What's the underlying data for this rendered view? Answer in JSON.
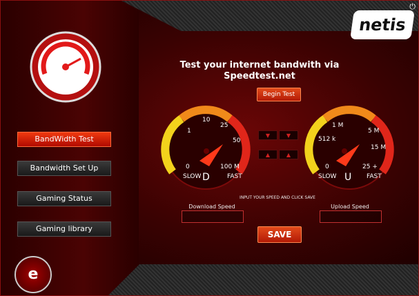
{
  "header": {
    "brand": "netis",
    "power_icon": "power-icon"
  },
  "main": {
    "title_line1": "Test your internet bandwith via",
    "title_line2": "Speedtest.net",
    "begin_button": "Begin Test",
    "hint": "INPUT YOUR SPEED AND CLICK SAVE",
    "download_label": "Download Speed",
    "upload_label": "Upload Speed",
    "save_button": "SAVE",
    "download_value": "",
    "upload_value": ""
  },
  "sidebar": {
    "items": [
      {
        "label": "BandWidth Test",
        "active": true
      },
      {
        "label": "Bandwidth Set Up",
        "active": false
      },
      {
        "label": "Gaming Status",
        "active": false
      },
      {
        "label": "Gaming library",
        "active": false
      }
    ]
  },
  "gauges": {
    "download": {
      "ticks": [
        "0",
        "1",
        "10",
        "25",
        "50",
        "100 M"
      ],
      "slow": "SLOW",
      "fast": "FAST",
      "letter": "D"
    },
    "upload": {
      "ticks": [
        "0",
        "512 k",
        "1 M",
        "5 M",
        "15 M",
        "25 +"
      ],
      "slow": "SLOW",
      "fast": "FAST",
      "letter": "U"
    }
  },
  "colors": {
    "accent": "#e0260c",
    "background": "#3a0202"
  }
}
